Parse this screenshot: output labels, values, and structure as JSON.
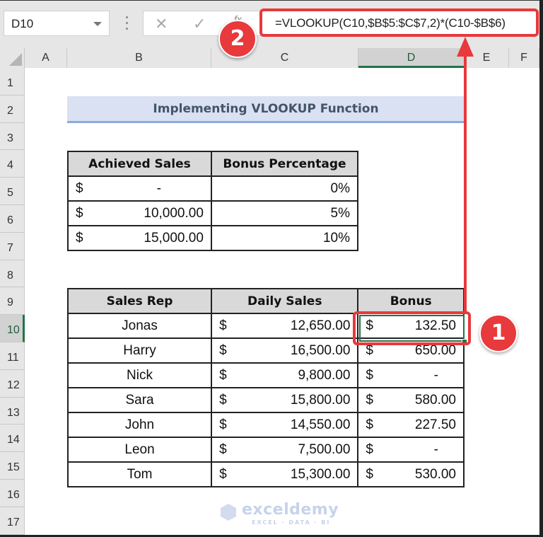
{
  "name_box": {
    "value": "D10"
  },
  "formula_bar": {
    "cancel_icon": "✕",
    "enter_icon": "✓",
    "fx_label": "fx",
    "formula": "=VLOOKUP(C10,$B$5:$C$7,2)*(C10-$B$6)"
  },
  "columns": [
    "A",
    "B",
    "C",
    "D",
    "E",
    "F"
  ],
  "selected_column": "D",
  "rows": [
    "1",
    "2",
    "3",
    "4",
    "5",
    "6",
    "7",
    "8",
    "9",
    "10",
    "11",
    "12",
    "13",
    "14",
    "15",
    "16",
    "17"
  ],
  "selected_row": "10",
  "title": "Implementing VLOOKUP Function",
  "lookup_table": {
    "headers": [
      "Achieved Sales",
      "Bonus Percentage"
    ],
    "rows": [
      {
        "currency": "$",
        "sales": "-",
        "pct": "0%"
      },
      {
        "currency": "$",
        "sales": "10,000.00",
        "pct": "5%"
      },
      {
        "currency": "$",
        "sales": "15,000.00",
        "pct": "10%"
      }
    ]
  },
  "sales_table": {
    "headers": [
      "Sales Rep",
      "Daily Sales",
      "Bonus"
    ],
    "rows": [
      {
        "rep": "Jonas",
        "cur1": "$",
        "sales": "12,650.00",
        "cur2": "$",
        "bonus": "132.50"
      },
      {
        "rep": "Harry",
        "cur1": "$",
        "sales": "16,500.00",
        "cur2": "$",
        "bonus": "650.00"
      },
      {
        "rep": "Nick",
        "cur1": "$",
        "sales": "9,800.00",
        "cur2": "$",
        "bonus": "-"
      },
      {
        "rep": "Sara",
        "cur1": "$",
        "sales": "15,800.00",
        "cur2": "$",
        "bonus": "580.00"
      },
      {
        "rep": "John",
        "cur1": "$",
        "sales": "14,550.00",
        "cur2": "$",
        "bonus": "227.50"
      },
      {
        "rep": "Leon",
        "cur1": "$",
        "sales": "7,500.00",
        "cur2": "$",
        "bonus": "-"
      },
      {
        "rep": "Tom",
        "cur1": "$",
        "sales": "15,300.00",
        "cur2": "$",
        "bonus": "530.00"
      }
    ]
  },
  "annotations": {
    "badge1": "1",
    "badge2": "2",
    "color": "#e8393c"
  },
  "watermark": {
    "name": "exceldemy",
    "tagline": "EXCEL · DATA · BI"
  }
}
